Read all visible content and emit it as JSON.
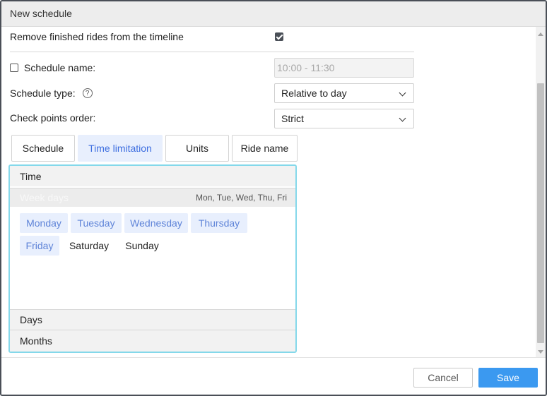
{
  "dialog": {
    "title": "New schedule"
  },
  "form": {
    "remove_finished": {
      "label": "Remove finished rides from the timeline",
      "checked": true
    },
    "schedule_name": {
      "label": "Schedule name:",
      "checked": false,
      "placeholder": "10:00 - 11:30"
    },
    "schedule_type": {
      "label": "Schedule type:",
      "help_icon": "?",
      "value": "Relative to day"
    },
    "check_points_order": {
      "label": "Check points order:",
      "value": "Strict"
    }
  },
  "tabs": [
    {
      "label": "Schedule",
      "active": false
    },
    {
      "label": "Time limitation",
      "active": true
    },
    {
      "label": "Units",
      "active": false
    },
    {
      "label": "Ride name",
      "active": false
    }
  ],
  "panel": {
    "time": {
      "header": "Time"
    },
    "week_days": {
      "label": "Week days",
      "summary": "Mon, Tue, Wed, Thu, Fri",
      "days": [
        {
          "label": "Monday",
          "selected": true
        },
        {
          "label": "Tuesday",
          "selected": true
        },
        {
          "label": "Wednesday",
          "selected": true
        },
        {
          "label": "Thursday",
          "selected": true
        },
        {
          "label": "Friday",
          "selected": true
        },
        {
          "label": "Saturday",
          "selected": false
        },
        {
          "label": "Sunday",
          "selected": false
        }
      ]
    },
    "days_header": "Days",
    "months_header": "Months"
  },
  "footer": {
    "cancel_label": "Cancel",
    "save_label": "Save"
  },
  "colors": {
    "accent": "#3b99f0",
    "selected_bg": "#e8effd",
    "selected_text": "#5f84d8",
    "panel_border": "#84d8ea"
  }
}
